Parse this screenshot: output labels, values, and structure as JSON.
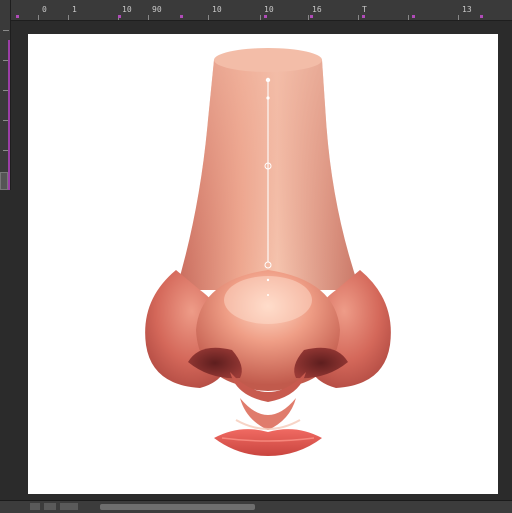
{
  "window": {
    "document_zoom": "",
    "colors": {
      "workspace": "#2b2b2b",
      "ruler": "#3a3a3a",
      "guide": "#9b3ea6",
      "canvas": "#ffffff"
    }
  },
  "ruler": {
    "top_ticks": [
      "0",
      "1",
      "10",
      "90",
      "10",
      "10",
      "16",
      "T",
      "13"
    ]
  },
  "canvas": {
    "artwork": "nose-illustration"
  }
}
